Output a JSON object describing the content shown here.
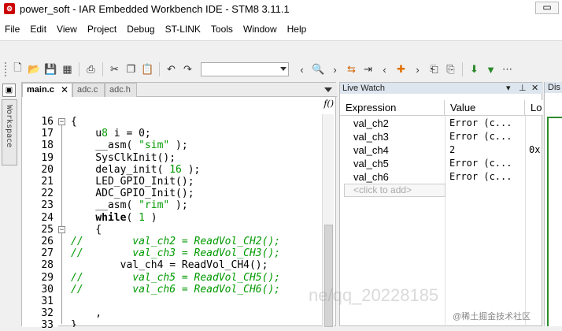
{
  "window": {
    "title": "power_soft - IAR Embedded Workbench IDE - STM8 3.11.1",
    "app_icon": "iar-app-icon"
  },
  "menu": [
    "File",
    "Edit",
    "View",
    "Project",
    "Debug",
    "ST-LINK",
    "Tools",
    "Window",
    "Help"
  ],
  "toolbar": {
    "combo_value": ""
  },
  "workspace": {
    "label": "Workspace"
  },
  "editor": {
    "tabs": [
      {
        "label": "main.c",
        "active": true,
        "close": "✕"
      },
      {
        "label": "adc.c",
        "active": false
      },
      {
        "label": "adc.h",
        "active": false
      }
    ],
    "func_button": "f()",
    "line_numbers": [
      "16",
      "17",
      "18",
      "19",
      "20",
      "21",
      "22",
      "23",
      "24",
      "25",
      "26",
      "27",
      "28",
      "29",
      "30",
      "31",
      "32",
      "33"
    ],
    "lines": [
      {
        "text": "{",
        "type": "code"
      },
      {
        "text": "    u8 i = 0;",
        "type": "code"
      },
      {
        "text": "    __asm( \"sim\" );",
        "type": "code"
      },
      {
        "text": "    SysClkInit();",
        "type": "code"
      },
      {
        "text": "    delay_init( 16 );",
        "type": "code"
      },
      {
        "text": "    LED_GPIO_Init();",
        "type": "code"
      },
      {
        "text": "    ADC_GPIO_Init();",
        "type": "code"
      },
      {
        "text": "    __asm( \"rim\" );",
        "type": "code"
      },
      {
        "text": "    while( 1 )",
        "type": "code"
      },
      {
        "text": "    {",
        "type": "code"
      },
      {
        "text": "//        val_ch2 = ReadVol_CH2();",
        "type": "comment"
      },
      {
        "text": "//        val_ch3 = ReadVol_CH3();",
        "type": "comment"
      },
      {
        "text": "        val_ch4 = ReadVol_CH4();",
        "type": "code"
      },
      {
        "text": "//        val_ch5 = ReadVol_CH5();",
        "type": "comment"
      },
      {
        "text": "//        val_ch6 = ReadVol_CH6();",
        "type": "comment"
      },
      {
        "text": "",
        "type": "code"
      },
      {
        "text": "    ,",
        "type": "code"
      },
      {
        "text": "}",
        "type": "code"
      }
    ]
  },
  "live_watch": {
    "title": "Live Watch",
    "columns": [
      "Expression",
      "Value",
      "Lo"
    ],
    "rows": [
      {
        "expr": "val_ch2",
        "value": "Error (c...",
        "loc": ""
      },
      {
        "expr": "val_ch3",
        "value": "Error (c...",
        "loc": ""
      },
      {
        "expr": "val_ch4",
        "value": "2",
        "loc": "0x"
      },
      {
        "expr": "val_ch5",
        "value": "Error (c...",
        "loc": ""
      },
      {
        "expr": "val_ch6",
        "value": "Error (c...",
        "loc": ""
      }
    ],
    "add_placeholder": "<click to add>"
  },
  "disasm": {
    "title": "Dis"
  },
  "watermark": {
    "text": "@稀土掘金技术社区",
    "overlay": "ne/qq_20228185"
  }
}
